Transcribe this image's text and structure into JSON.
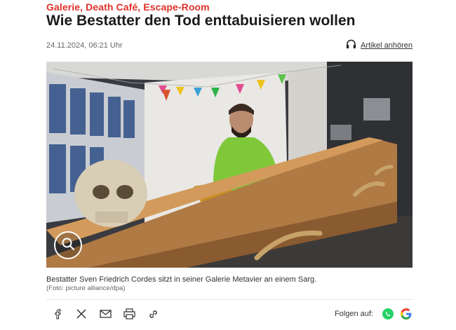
{
  "article": {
    "kicker": "Galerie, Death Café, Escape-Room",
    "headline": "Wie Bestatter den Tod enttabuisieren wollen",
    "date": "24.11.2024, 06:21 Uhr",
    "listen_label": "Artikel anhören",
    "listen_icon": "headphones-icon"
  },
  "image": {
    "zoom_icon": "magnifier-icon",
    "caption": "Bestatter Sven Friedrich Cordes sitzt in seiner Galerie Metavier an einem Sarg.",
    "credit": "(Foto: picture alliance/dpa)"
  },
  "share": {
    "icons": [
      "facebook-icon",
      "x-icon",
      "mail-icon",
      "print-icon",
      "link-icon"
    ],
    "follow_label": "Folgen auf:",
    "follow_icons": [
      "whatsapp-icon",
      "google-icon"
    ]
  },
  "colors": {
    "accent": "#e0312a",
    "whatsapp": "#25d366"
  }
}
